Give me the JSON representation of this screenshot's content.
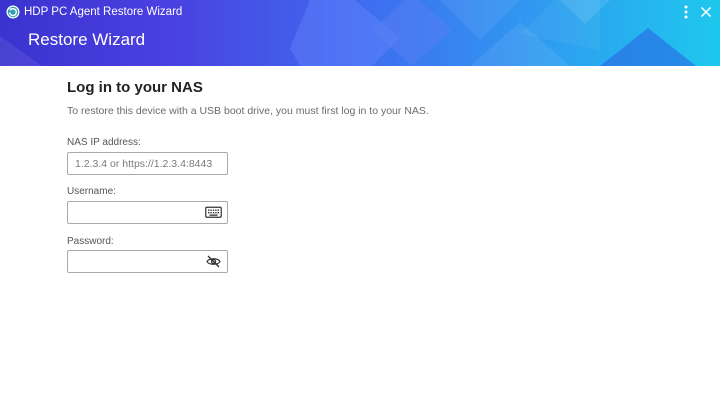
{
  "window": {
    "app_title": "HDP PC Agent Restore Wizard",
    "header_title": "Restore Wizard"
  },
  "form": {
    "title": "Log in to your NAS",
    "description": "To restore this device with a USB boot drive, you must first log in to your NAS.",
    "nas_ip": {
      "label": "NAS IP address:",
      "placeholder": "1.2.3.4 or https://1.2.3.4:8443",
      "value": ""
    },
    "username": {
      "label": "Username:",
      "value": "",
      "icon": "keyboard-icon"
    },
    "password": {
      "label": "Password:",
      "value": "",
      "icon": "eye-off-icon"
    }
  },
  "colors": {
    "header_gradient_start": "#3b33cf",
    "header_gradient_end": "#1ec8ee",
    "title_text": "#222222",
    "muted_text": "#6b6b6b",
    "field_border": "#a9a9a9"
  }
}
